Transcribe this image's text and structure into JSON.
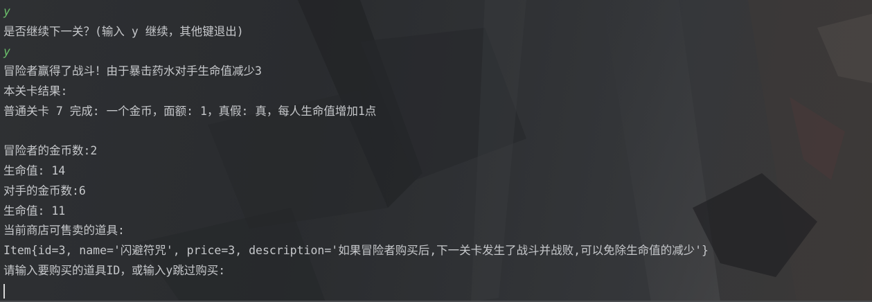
{
  "console": {
    "lines": [
      {
        "text": "y",
        "kind": "input"
      },
      {
        "text": "是否继续下一关？(输入 y 继续，其他键退出)",
        "kind": "output"
      },
      {
        "text": "y",
        "kind": "input"
      },
      {
        "text": "冒险者赢得了战斗！由于暴击药水对手生命值减少3",
        "kind": "output"
      },
      {
        "text": "本关卡结果:",
        "kind": "output"
      },
      {
        "text": "普通关卡 7 完成: 一个金币，面额: 1，真假: 真，每人生命值增加1点",
        "kind": "output"
      },
      {
        "text": "",
        "kind": "blank"
      },
      {
        "text": "冒险者的金币数:2",
        "kind": "output"
      },
      {
        "text": "生命值: 14",
        "kind": "output"
      },
      {
        "text": "对手的金币数:6",
        "kind": "output"
      },
      {
        "text": "生命值: 11",
        "kind": "output"
      },
      {
        "text": "当前商店可售卖的道具:",
        "kind": "output"
      },
      {
        "text": "Item{id=3, name='闪避符咒', price=3, description='如果冒险者购买后,下一关卡发生了战斗并战败,可以免除生命值的减少'}",
        "kind": "output"
      },
      {
        "text": "请输入要购买的道具ID，或输入y跳过购买:",
        "kind": "output"
      }
    ]
  },
  "colors": {
    "background": "#2b2d2f",
    "output_text": "#c6c8cb",
    "input_echo": "#6bbf6b",
    "caret": "#d8d8d8"
  }
}
